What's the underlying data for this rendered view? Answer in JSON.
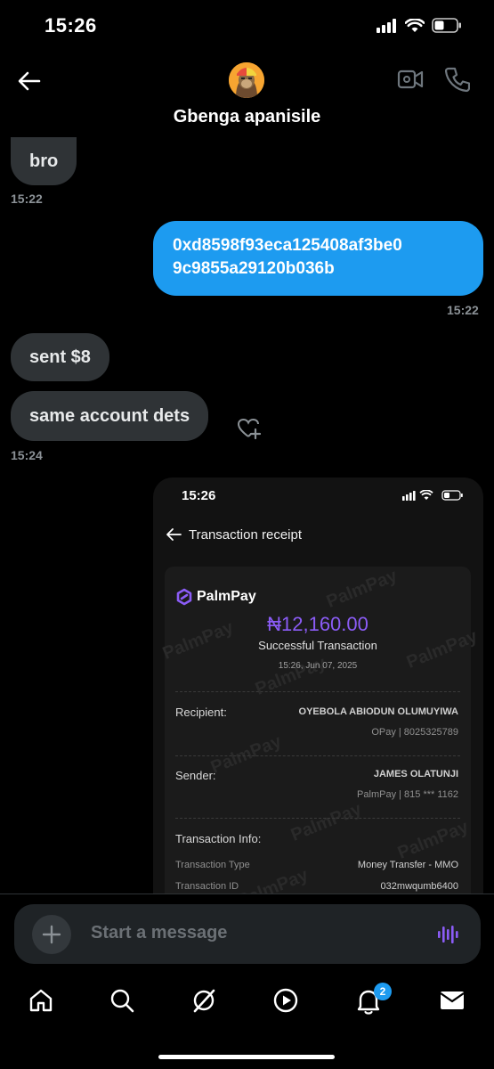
{
  "status_bar": {
    "time": "15:26"
  },
  "header": {
    "contact_name": "Gbenga apanisile"
  },
  "messages": [
    {
      "text": "bro",
      "direction": "in"
    },
    {
      "time": "15:22"
    },
    {
      "text": "0xd8598f93eca125408af3be09c9855a29120b036b",
      "line1": "0xd8598f93eca125408af3be0",
      "line2": "9c9855a29120b036b",
      "direction": "out"
    },
    {
      "time": "15:22"
    },
    {
      "text": "sent $8",
      "direction": "in"
    },
    {
      "text": "same account dets",
      "direction": "in"
    },
    {
      "time": "15:24"
    }
  ],
  "receipt": {
    "status_time": "15:26",
    "title": "Transaction receipt",
    "brand": "PalmPay",
    "amount": "₦12,160.00",
    "status": "Successful Transaction",
    "datetime": "15:26, Jun 07, 2025",
    "recipient_label": "Recipient:",
    "recipient_name": "OYEBOLA ABIODUN OLUMUYIWA",
    "recipient_bank": "OPay | 8025325789",
    "sender_label": "Sender:",
    "sender_name": "JAMES OLATUNJI",
    "sender_bank": "PalmPay | 815 *** 1162",
    "info_label": "Transaction Info:",
    "type_label": "Transaction Type",
    "type_value": "Money Transfer - MMO",
    "id_label": "Transaction ID",
    "id_value": "032mwqumb6400",
    "watermark": "PalmPay",
    "accent_color": "#8b5cf6"
  },
  "composer": {
    "placeholder": "Start a message"
  },
  "tabbar": {
    "items": [
      "home-icon",
      "search-icon",
      "grok-icon",
      "video-icon",
      "notifications-icon",
      "messages-icon"
    ],
    "notification_count": "2"
  },
  "colors": {
    "accent": "#1d9bf0",
    "incoming_bubble": "#2f3336",
    "background": "#000000"
  }
}
